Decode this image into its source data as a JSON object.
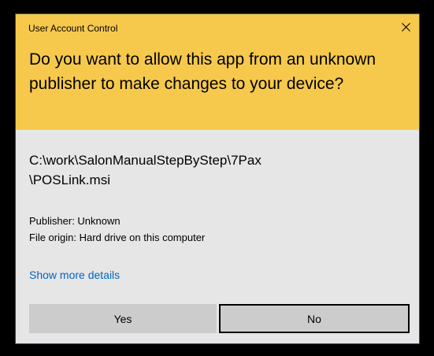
{
  "dialog": {
    "title": "User Account Control",
    "close_icon": "close-icon",
    "question": "Do you want to allow this app from an unknown publisher to make changes to your device?",
    "file_path": "C:\\work\\SalonManualStepByStep\\7Pax\n\\POSLink.msi",
    "publisher": "Publisher: Unknown",
    "file_origin": "File origin: Hard drive on this computer",
    "show_details_label": "Show more details",
    "yes_label": "Yes",
    "no_label": "No"
  },
  "colors": {
    "header_bg": "#f6c94d",
    "body_bg": "#e6e6e6",
    "link": "#0067c0",
    "button_bg": "#cccccc"
  }
}
